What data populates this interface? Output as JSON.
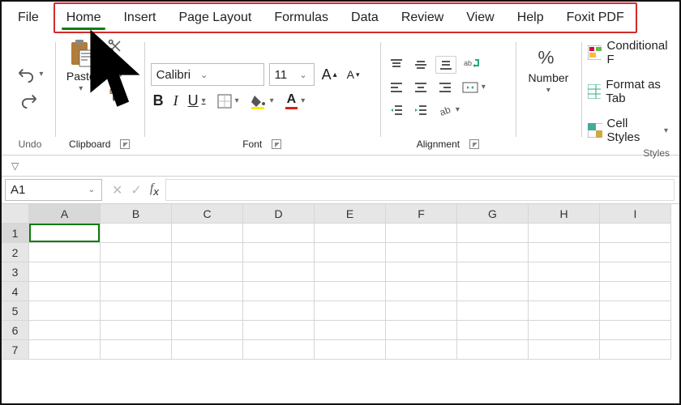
{
  "tabs": [
    "File",
    "Home",
    "Insert",
    "Page Layout",
    "Formulas",
    "Data",
    "Review",
    "View",
    "Help",
    "Foxit PDF"
  ],
  "active_tab": "Home",
  "groups": {
    "undo": "Undo",
    "clipboard": "Clipboard",
    "font": "Font",
    "alignment": "Alignment",
    "number": "Number",
    "styles": "Styles"
  },
  "clipboard": {
    "paste": "Paste"
  },
  "font": {
    "name": "Calibri",
    "size": "11",
    "bold": "B",
    "italic": "I",
    "underline": "U"
  },
  "number": {
    "label": "Number"
  },
  "styles": {
    "cond": "Conditional F",
    "table": "Format as Tab",
    "cell": "Cell Styles"
  },
  "namebox": "A1",
  "columns": [
    "A",
    "B",
    "C",
    "D",
    "E",
    "F",
    "G",
    "H",
    "I"
  ],
  "rows": [
    "1",
    "2",
    "3",
    "4",
    "5",
    "6",
    "7"
  ]
}
